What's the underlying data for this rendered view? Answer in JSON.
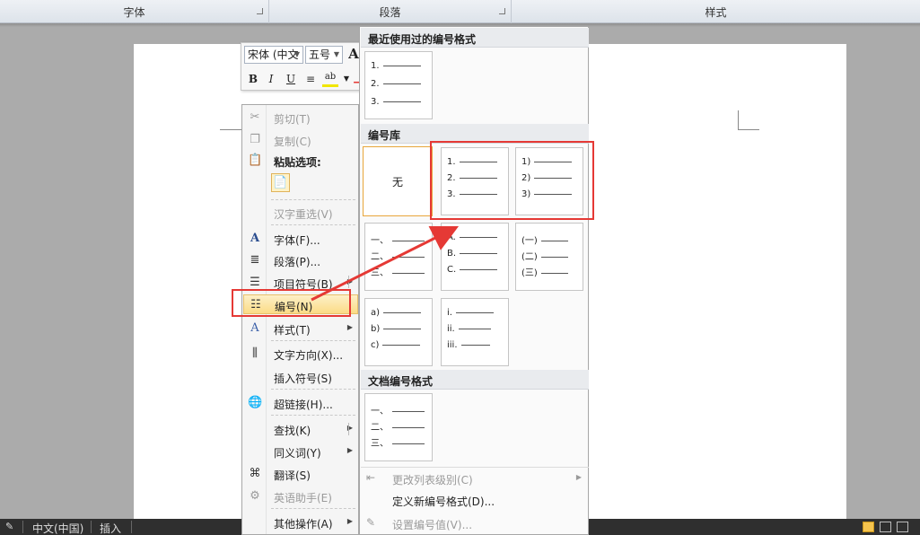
{
  "ribbon": {
    "groups": [
      "字体",
      "段落",
      "样式"
    ]
  },
  "status_bar": {
    "language": "中文(中国)",
    "mode": "插入"
  },
  "mini_toolbar": {
    "font_name": "宋体 (中文",
    "font_size": "五号",
    "grow_font": "A",
    "bold": "B",
    "italic": "I",
    "underline": "U",
    "highlight": "ab"
  },
  "context_menu": {
    "items": [
      {
        "label": "剪切(T)",
        "disabled": true
      },
      {
        "label": "复制(C)",
        "disabled": true
      },
      {
        "label": "粘贴选项:",
        "header": true
      },
      {
        "label": "汉字重选(V)",
        "disabled": true
      },
      {
        "label": "字体(F)..."
      },
      {
        "label": "段落(P)..."
      },
      {
        "label": "项目符号(B)"
      },
      {
        "label": "编号(N)",
        "highlighted": true
      },
      {
        "label": "样式(T)"
      },
      {
        "label": "文字方向(X)..."
      },
      {
        "label": "插入符号(S)"
      },
      {
        "label": "超链接(H)..."
      },
      {
        "label": "查找(K)"
      },
      {
        "label": "同义词(Y)"
      },
      {
        "label": "翻译(S)"
      },
      {
        "label": "英语助手(E)",
        "disabled": true
      },
      {
        "label": "其他操作(A)"
      }
    ]
  },
  "numbering_gallery": {
    "sections": {
      "recent": "最近使用过的编号格式",
      "library": "编号库",
      "document": "文档编号格式"
    },
    "recent_tile": [
      "1.",
      "2.",
      "3."
    ],
    "library_tiles": [
      {
        "none_label": "无"
      },
      {
        "markers": [
          "1.",
          "2.",
          "3."
        ]
      },
      {
        "markers": [
          "1)",
          "2)",
          "3)"
        ]
      },
      {
        "markers": [
          "一、",
          "二、",
          "三、"
        ]
      },
      {
        "markers": [
          "A.",
          "B.",
          "C."
        ]
      },
      {
        "markers": [
          "(一)",
          "(二)",
          "(三)"
        ]
      },
      {
        "markers": [
          "a)",
          "b)",
          "c)"
        ]
      },
      {
        "markers": [
          "i.",
          "ii.",
          "iii."
        ]
      }
    ],
    "document_tile": [
      "一、",
      "二、",
      "三、"
    ],
    "footer_items": [
      {
        "label": "更改列表级别(C)",
        "disabled": true
      },
      {
        "label": "定义新编号格式(D)..."
      },
      {
        "label": "设置编号值(V)...",
        "disabled": true
      }
    ]
  },
  "colors": {
    "highlight_border": "#e53935",
    "accent": "#f5c44e"
  }
}
